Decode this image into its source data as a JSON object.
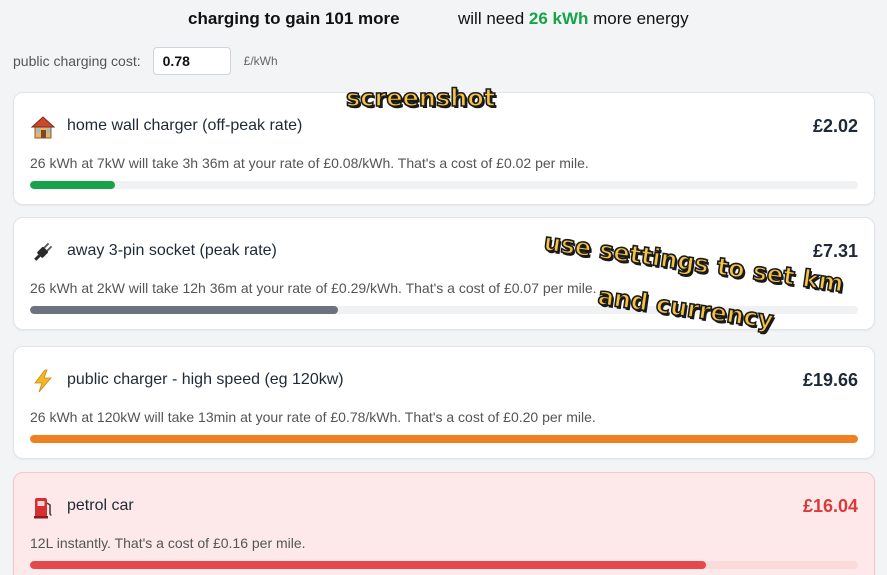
{
  "summary": {
    "left_text": "charging to gain 101 more",
    "right_prefix": "will need ",
    "right_energy": "26 kWh",
    "right_suffix": " more energy",
    "energy_color": "#16a34a"
  },
  "cost": {
    "label": "public charging cost:",
    "value": "0.78",
    "unit": "£/kWh"
  },
  "cards": [
    {
      "icon": "house-icon",
      "title": "home wall charger (off-peak rate)",
      "price": "£2.02",
      "description": "26 kWh at 7kW will take 3h 36m at your rate of £0.08/kWh. That's a cost of £0.02 per mile.",
      "bar_fraction": 0.103,
      "bar_color": "#16a34a"
    },
    {
      "icon": "plug-icon",
      "title": "away 3-pin socket (peak rate)",
      "price": "£7.31",
      "description": "26 kWh at 2kW will take 12h 36m at your rate of £0.29/kWh. That's a cost of £0.07 per mile.",
      "bar_fraction": 0.372,
      "bar_color": "#6b7280"
    },
    {
      "icon": "lightning-icon",
      "title": "public charger - high speed (eg 120kw)",
      "price": "£19.66",
      "description": "26 kWh at 120kW will take 13min at your rate of £0.78/kWh. That's a cost of £0.20 per mile.",
      "bar_fraction": 1.0,
      "bar_color": "#f07f22"
    },
    {
      "icon": "fuel-pump-icon",
      "title": "petrol car",
      "price": "£16.04",
      "description": "12L instantly. That's a cost of £0.16 per mile.",
      "bar_fraction": 0.816,
      "bar_color": "#e5484d"
    }
  ],
  "overlays": {
    "screenshot": "screenshot",
    "settings": "use settings to set km",
    "currency": "and currency"
  }
}
